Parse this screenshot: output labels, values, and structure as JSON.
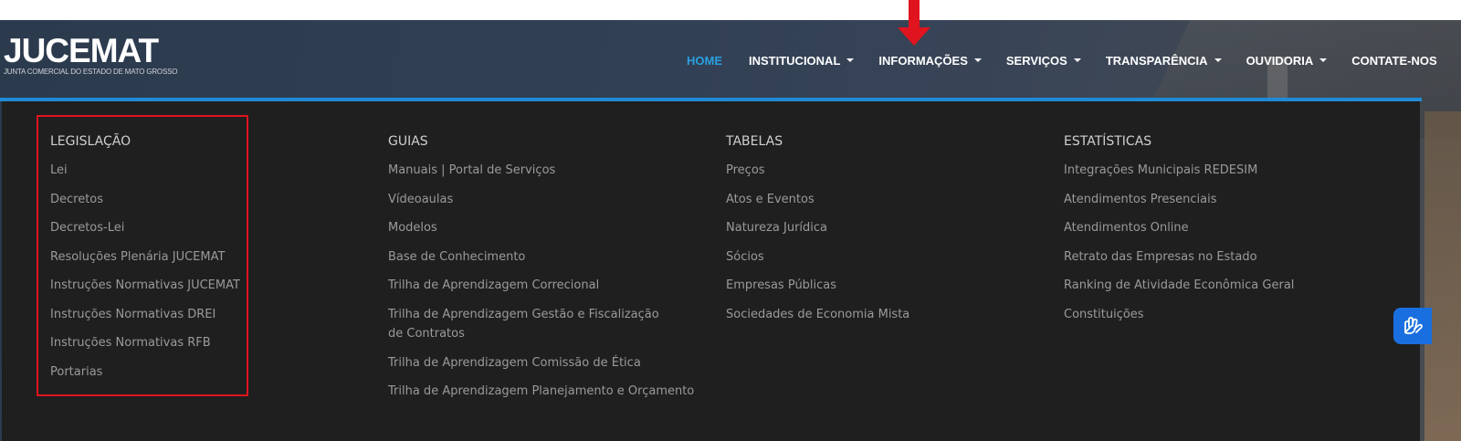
{
  "logo": {
    "name": "JUCEMAT",
    "subtitle": "JUNTA COMERCIAL DO ESTADO DE MATO GROSSO"
  },
  "nav": {
    "items": [
      {
        "label": "HOME",
        "active": true,
        "dropdown": false
      },
      {
        "label": "INSTITUCIONAL",
        "dropdown": true
      },
      {
        "label": "INFORMAÇÕES",
        "dropdown": true
      },
      {
        "label": "SERVIÇOS",
        "dropdown": true
      },
      {
        "label": "TRANSPARÊNCIA",
        "dropdown": true
      },
      {
        "label": "OUVIDORIA",
        "dropdown": true
      },
      {
        "label": "CONTATE-NOS",
        "dropdown": false
      }
    ]
  },
  "menu": {
    "columns": [
      {
        "title": "LEGISLAÇÃO",
        "items": [
          "Lei",
          "Decretos",
          "Decretos-Lei",
          "Resoluções Plenária JUCEMAT",
          "Instruções Normativas JUCEMAT",
          "Instruções Normativas DREI",
          "Instruções Normativas RFB",
          "Portarias"
        ]
      },
      {
        "title": "GUIAS",
        "items": [
          "Manuais | Portal de Serviços",
          "Vídeoaulas",
          "Modelos",
          "Base de Conhecimento",
          "Trilha de Aprendizagem Correcional",
          "Trilha de Aprendizagem Gestão e Fiscalização de Contratos",
          "Trilha de Aprendizagem Comissão de Ética",
          "Trilha de Aprendizagem Planejamento e Orçamento"
        ]
      },
      {
        "title": "TABELAS",
        "items": [
          "Preços",
          "Atos e Eventos",
          "Natureza Jurídica",
          "Sócios",
          "Empresas Públicas",
          "Sociedades de Economia Mista"
        ]
      },
      {
        "title": "ESTATÍSTICAS",
        "items": [
          "Integrações Municipais REDESIM",
          "Atendimentos Presenciais",
          "Atendimentos Online",
          "Retrato das Empresas no Estado",
          "Ranking de Atividade Econômica Geral",
          "Constituições"
        ]
      }
    ]
  },
  "colors": {
    "accent": "#1f8bd6",
    "active_nav": "#2a9fe0",
    "annotation_red": "#e0141e",
    "menu_bg": "#1f1f1f",
    "accessibility_button": "#1a6fe0"
  },
  "icons": {
    "accessibility": "sign-language-hands-icon",
    "annotation_arrow": "red-down-arrow-icon"
  }
}
